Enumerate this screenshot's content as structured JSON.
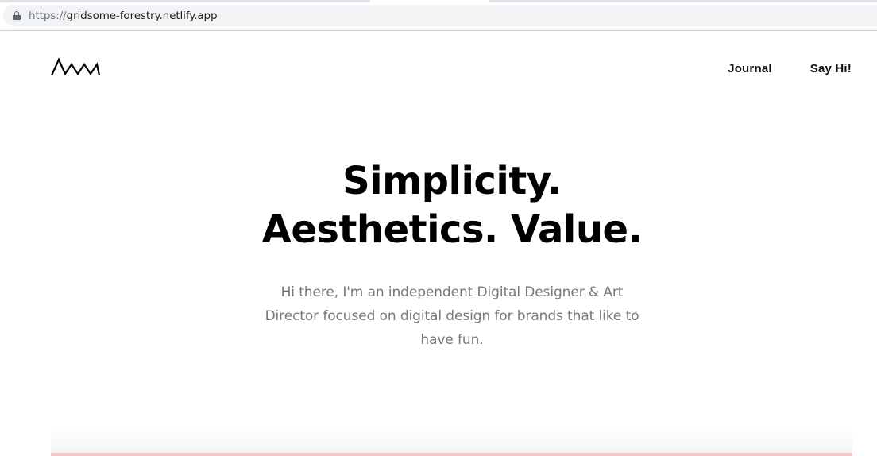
{
  "browser": {
    "url_scheme": "https://",
    "url_host": "gridsome-forestry.netlify.app",
    "lock_icon": "lock-icon"
  },
  "header": {
    "logo_icon": "mountain-wave-logo-icon",
    "nav": [
      {
        "label": "Journal"
      },
      {
        "label": "Say Hi!"
      }
    ]
  },
  "hero": {
    "title_line1": "Simplicity.",
    "title_line2": "Aesthetics. Value.",
    "subtitle": "Hi there, I'm an independent Digital Designer & Art Director focused on digital design for brands that like to have fun."
  },
  "colors": {
    "accent_bar": "#f3c3ca",
    "subtitle_text": "#787878",
    "title_text": "#000000"
  }
}
